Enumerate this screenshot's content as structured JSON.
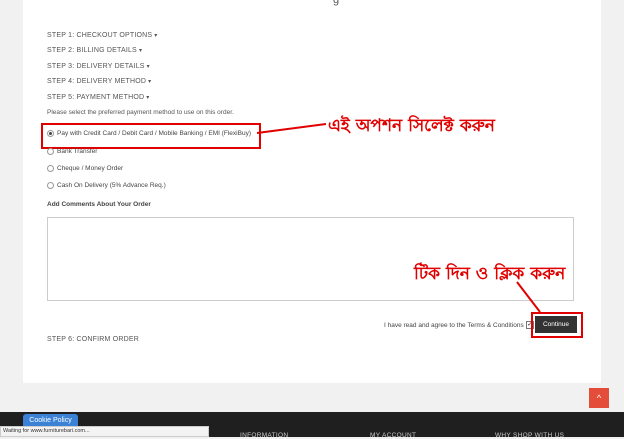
{
  "page": {
    "title_fragment": "g"
  },
  "steps": {
    "s1": "STEP 1: CHECKOUT OPTIONS",
    "s2": "STEP 2: BILLING DETAILS",
    "s3": "STEP 3: DELIVERY DETAILS",
    "s4": "STEP 4: DELIVERY METHOD",
    "s5": "STEP 5: PAYMENT METHOD",
    "s6": "STEP 6: CONFIRM ORDER",
    "caret": "▾"
  },
  "payment": {
    "note": "Please select the preferred payment method to use on this order.",
    "options": [
      {
        "label": "Pay with Credit Card / Debit Card / Mobile Banking / EMI (FlexiBuy)",
        "selected": true
      },
      {
        "label": "Bank Transfer",
        "selected": false
      },
      {
        "label": "Cheque / Money Order",
        "selected": false
      },
      {
        "label": "Cash On Delivery (5% Advance Req.)",
        "selected": false
      }
    ]
  },
  "comments": {
    "label": "Add Comments About Your Order",
    "value": ""
  },
  "terms": {
    "text": "I have read and agree to the Terms & Conditions",
    "checked": true,
    "check_mark": "✓"
  },
  "continue_label": "Continue",
  "annotations": {
    "select_option": "এই অপশন সিলেক্ট করুন",
    "tick_and_click": "টিক দিন ও ক্লিক করুন"
  },
  "scroll_top_icon": "^",
  "cookie_policy": "Cookie Policy",
  "status_bar": "Waiting for www.furniturebari.com...",
  "footer_items": [
    "INFORMATION",
    "MY ACCOUNT",
    "WHY SHOP WITH US"
  ],
  "colors": {
    "annotation": "#e00000",
    "button": "#333333",
    "scroll_top": "#e44d3a",
    "cookie": "#3b82d6",
    "footer": "#1f1f1f"
  }
}
